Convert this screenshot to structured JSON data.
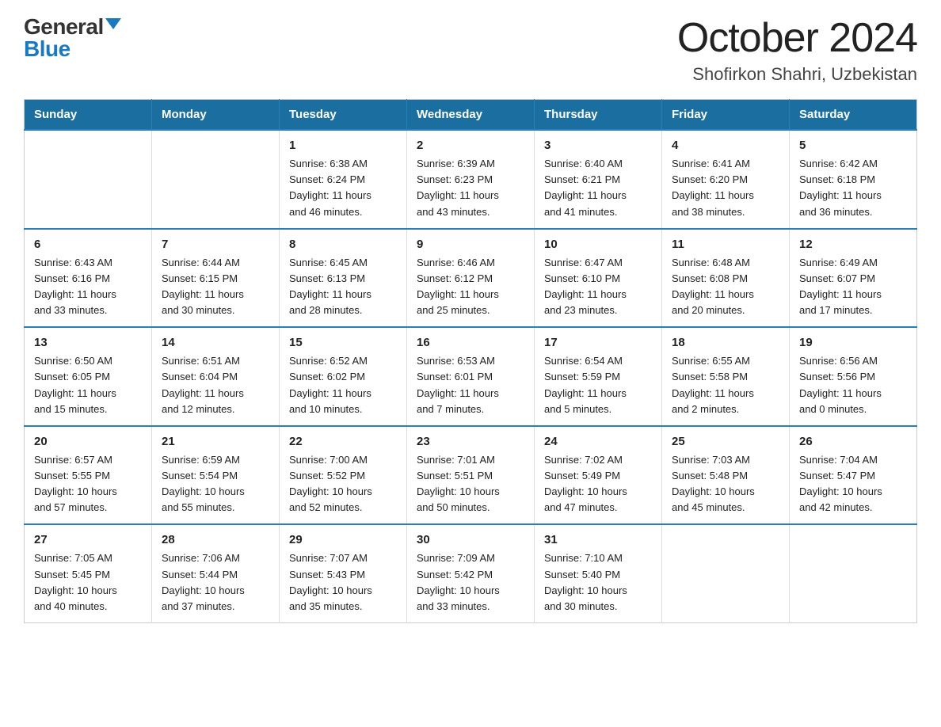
{
  "logo": {
    "general": "General",
    "blue": "Blue"
  },
  "title": "October 2024",
  "subtitle": "Shofirkon Shahri, Uzbekistan",
  "header_days": [
    "Sunday",
    "Monday",
    "Tuesday",
    "Wednesday",
    "Thursday",
    "Friday",
    "Saturday"
  ],
  "weeks": [
    [
      {
        "day": "",
        "info": ""
      },
      {
        "day": "",
        "info": ""
      },
      {
        "day": "1",
        "info": "Sunrise: 6:38 AM\nSunset: 6:24 PM\nDaylight: 11 hours\nand 46 minutes."
      },
      {
        "day": "2",
        "info": "Sunrise: 6:39 AM\nSunset: 6:23 PM\nDaylight: 11 hours\nand 43 minutes."
      },
      {
        "day": "3",
        "info": "Sunrise: 6:40 AM\nSunset: 6:21 PM\nDaylight: 11 hours\nand 41 minutes."
      },
      {
        "day": "4",
        "info": "Sunrise: 6:41 AM\nSunset: 6:20 PM\nDaylight: 11 hours\nand 38 minutes."
      },
      {
        "day": "5",
        "info": "Sunrise: 6:42 AM\nSunset: 6:18 PM\nDaylight: 11 hours\nand 36 minutes."
      }
    ],
    [
      {
        "day": "6",
        "info": "Sunrise: 6:43 AM\nSunset: 6:16 PM\nDaylight: 11 hours\nand 33 minutes."
      },
      {
        "day": "7",
        "info": "Sunrise: 6:44 AM\nSunset: 6:15 PM\nDaylight: 11 hours\nand 30 minutes."
      },
      {
        "day": "8",
        "info": "Sunrise: 6:45 AM\nSunset: 6:13 PM\nDaylight: 11 hours\nand 28 minutes."
      },
      {
        "day": "9",
        "info": "Sunrise: 6:46 AM\nSunset: 6:12 PM\nDaylight: 11 hours\nand 25 minutes."
      },
      {
        "day": "10",
        "info": "Sunrise: 6:47 AM\nSunset: 6:10 PM\nDaylight: 11 hours\nand 23 minutes."
      },
      {
        "day": "11",
        "info": "Sunrise: 6:48 AM\nSunset: 6:08 PM\nDaylight: 11 hours\nand 20 minutes."
      },
      {
        "day": "12",
        "info": "Sunrise: 6:49 AM\nSunset: 6:07 PM\nDaylight: 11 hours\nand 17 minutes."
      }
    ],
    [
      {
        "day": "13",
        "info": "Sunrise: 6:50 AM\nSunset: 6:05 PM\nDaylight: 11 hours\nand 15 minutes."
      },
      {
        "day": "14",
        "info": "Sunrise: 6:51 AM\nSunset: 6:04 PM\nDaylight: 11 hours\nand 12 minutes."
      },
      {
        "day": "15",
        "info": "Sunrise: 6:52 AM\nSunset: 6:02 PM\nDaylight: 11 hours\nand 10 minutes."
      },
      {
        "day": "16",
        "info": "Sunrise: 6:53 AM\nSunset: 6:01 PM\nDaylight: 11 hours\nand 7 minutes."
      },
      {
        "day": "17",
        "info": "Sunrise: 6:54 AM\nSunset: 5:59 PM\nDaylight: 11 hours\nand 5 minutes."
      },
      {
        "day": "18",
        "info": "Sunrise: 6:55 AM\nSunset: 5:58 PM\nDaylight: 11 hours\nand 2 minutes."
      },
      {
        "day": "19",
        "info": "Sunrise: 6:56 AM\nSunset: 5:56 PM\nDaylight: 11 hours\nand 0 minutes."
      }
    ],
    [
      {
        "day": "20",
        "info": "Sunrise: 6:57 AM\nSunset: 5:55 PM\nDaylight: 10 hours\nand 57 minutes."
      },
      {
        "day": "21",
        "info": "Sunrise: 6:59 AM\nSunset: 5:54 PM\nDaylight: 10 hours\nand 55 minutes."
      },
      {
        "day": "22",
        "info": "Sunrise: 7:00 AM\nSunset: 5:52 PM\nDaylight: 10 hours\nand 52 minutes."
      },
      {
        "day": "23",
        "info": "Sunrise: 7:01 AM\nSunset: 5:51 PM\nDaylight: 10 hours\nand 50 minutes."
      },
      {
        "day": "24",
        "info": "Sunrise: 7:02 AM\nSunset: 5:49 PM\nDaylight: 10 hours\nand 47 minutes."
      },
      {
        "day": "25",
        "info": "Sunrise: 7:03 AM\nSunset: 5:48 PM\nDaylight: 10 hours\nand 45 minutes."
      },
      {
        "day": "26",
        "info": "Sunrise: 7:04 AM\nSunset: 5:47 PM\nDaylight: 10 hours\nand 42 minutes."
      }
    ],
    [
      {
        "day": "27",
        "info": "Sunrise: 7:05 AM\nSunset: 5:45 PM\nDaylight: 10 hours\nand 40 minutes."
      },
      {
        "day": "28",
        "info": "Sunrise: 7:06 AM\nSunset: 5:44 PM\nDaylight: 10 hours\nand 37 minutes."
      },
      {
        "day": "29",
        "info": "Sunrise: 7:07 AM\nSunset: 5:43 PM\nDaylight: 10 hours\nand 35 minutes."
      },
      {
        "day": "30",
        "info": "Sunrise: 7:09 AM\nSunset: 5:42 PM\nDaylight: 10 hours\nand 33 minutes."
      },
      {
        "day": "31",
        "info": "Sunrise: 7:10 AM\nSunset: 5:40 PM\nDaylight: 10 hours\nand 30 minutes."
      },
      {
        "day": "",
        "info": ""
      },
      {
        "day": "",
        "info": ""
      }
    ]
  ]
}
